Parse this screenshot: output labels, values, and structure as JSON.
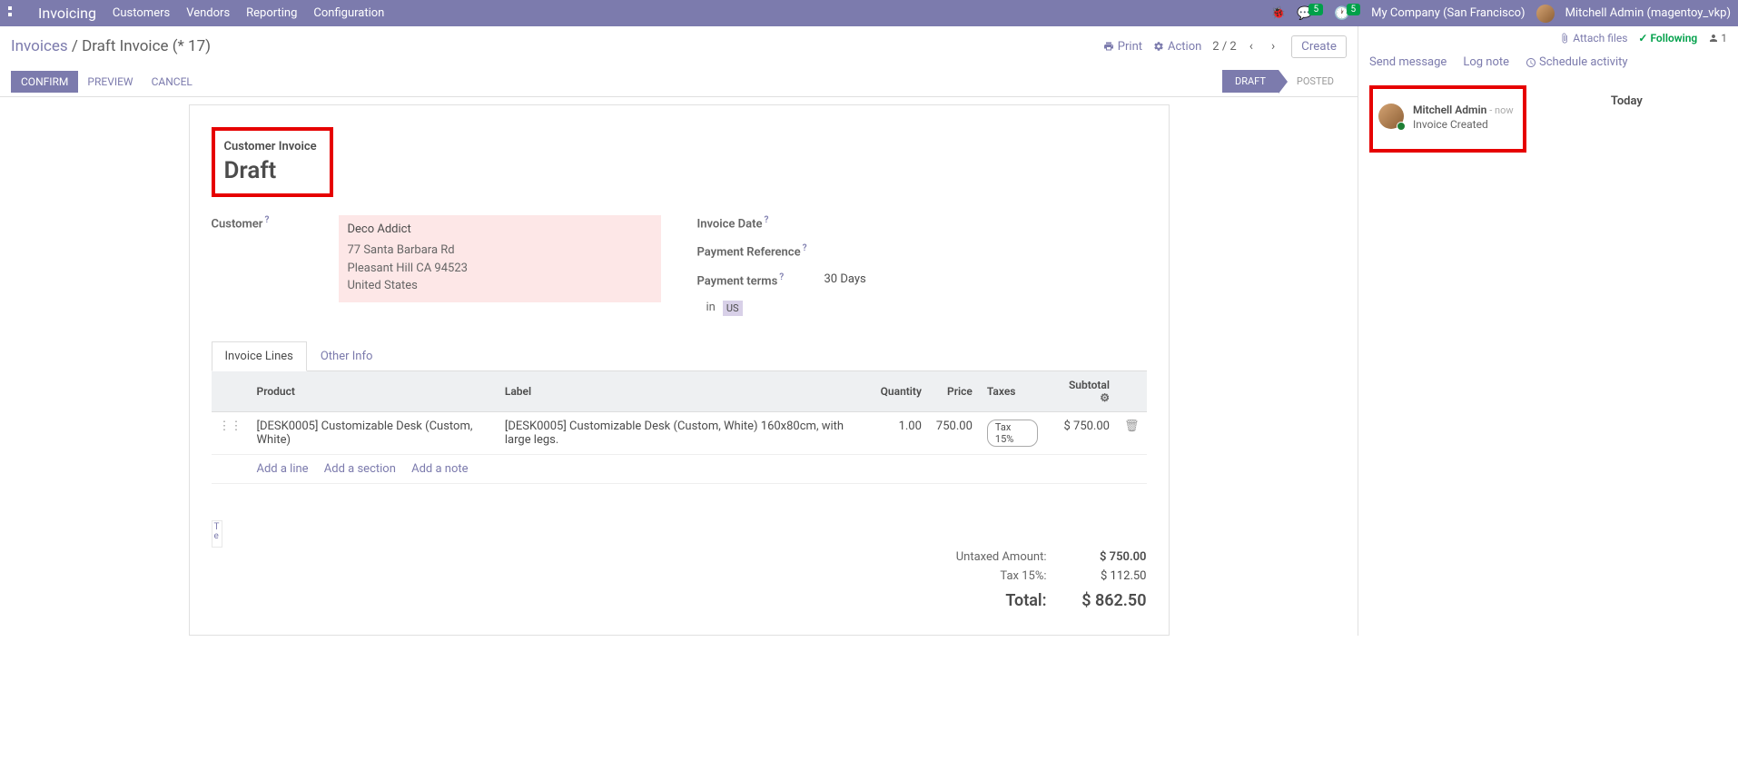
{
  "topnav": {
    "brand": "Invoicing",
    "menu": [
      "Customers",
      "Vendors",
      "Reporting",
      "Configuration"
    ],
    "chat_badge": "5",
    "activity_badge": "5",
    "company": "My Company (San Francisco)",
    "user": "Mitchell Admin (magentoy_vkp)"
  },
  "breadcrumb": {
    "root": "Invoices",
    "current": "Draft Invoice (* 17)"
  },
  "controls": {
    "print": "Print",
    "action": "Action",
    "pager": "2 / 2",
    "create": "Create"
  },
  "status_buttons": {
    "confirm": "CONFIRM",
    "preview": "PREVIEW",
    "cancel": "CANCEL",
    "draft": "DRAFT",
    "posted": "POSTED"
  },
  "header_box": {
    "type": "Customer Invoice",
    "state": "Draft"
  },
  "customer": {
    "label": "Customer",
    "name": "Deco Addict",
    "street": "77 Santa Barbara Rd",
    "city": "Pleasant Hill CA 94523",
    "country": "United States"
  },
  "fields": {
    "invoice_date_label": "Invoice Date",
    "payment_ref_label": "Payment Reference",
    "payment_terms_label": "Payment terms",
    "payment_terms_value": "30 Days",
    "in_label": "in",
    "currency": "US"
  },
  "tabs": {
    "lines": "Invoice Lines",
    "other": "Other Info"
  },
  "table": {
    "headers": {
      "product": "Product",
      "label": "Label",
      "quantity": "Quantity",
      "price": "Price",
      "taxes": "Taxes",
      "subtotal": "Subtotal"
    },
    "rows": [
      {
        "product": "[DESK0005] Customizable Desk (Custom, White)",
        "label": "[DESK0005] Customizable Desk (Custom, White) 160x80cm, with large legs.",
        "quantity": "1.00",
        "price": "750.00",
        "tax": "Tax 15%",
        "subtotal": "$ 750.00"
      }
    ],
    "actions": {
      "add_line": "Add a line",
      "add_section": "Add a section",
      "add_note": "Add a note"
    }
  },
  "totals": {
    "untaxed_label": "Untaxed Amount:",
    "untaxed_value": "$ 750.00",
    "tax_label": "Tax 15%:",
    "tax_value": "$ 112.50",
    "total_label": "Total:",
    "total_value": "$ 862.50"
  },
  "chatter": {
    "attach": "Attach files",
    "following": "Following",
    "follower_count": "1",
    "send_message": "Send message",
    "log_note": "Log note",
    "schedule": "Schedule activity",
    "day": "Today",
    "message": {
      "author": "Mitchell Admin",
      "time": "- now",
      "body": "Invoice Created"
    }
  }
}
